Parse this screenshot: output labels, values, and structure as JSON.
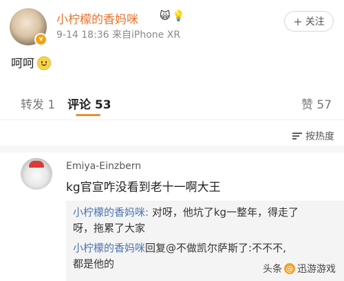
{
  "post": {
    "username": "小柠檬的香妈咪",
    "name_emojis": [
      "🙀",
      "💡"
    ],
    "verified_badge": "v",
    "meta": "9-14 18:36  来自iPhone XR",
    "follow_label": "关注",
    "text": "呵呵"
  },
  "tabs": [
    {
      "label": "转发 1"
    },
    {
      "label": "评论 53"
    },
    {
      "label": "赞 57"
    }
  ],
  "sort_label": "按热度",
  "comment": {
    "author": "Emiya-Einzbern",
    "text": "kg官宣咋没看到老十一啊大王",
    "replies": [
      {
        "line1_author": "小柠檬的香妈咪:",
        "line1_text": " 对呀，他坑了kg一整年，得走了",
        "line2": "呀，拖累了大家"
      },
      {
        "line1_author": "小柠檬的香妈咪",
        "line1_text": "回复@不做凯尔萨斯了:不不不,",
        "line2": "都是他的"
      }
    ]
  },
  "watermark": {
    "prefix": "头条",
    "name": "迅游游戏"
  },
  "colors": {
    "username": "#e8722a",
    "reply_author": "#4a74b0",
    "tab_underline": "#f28b2c"
  }
}
